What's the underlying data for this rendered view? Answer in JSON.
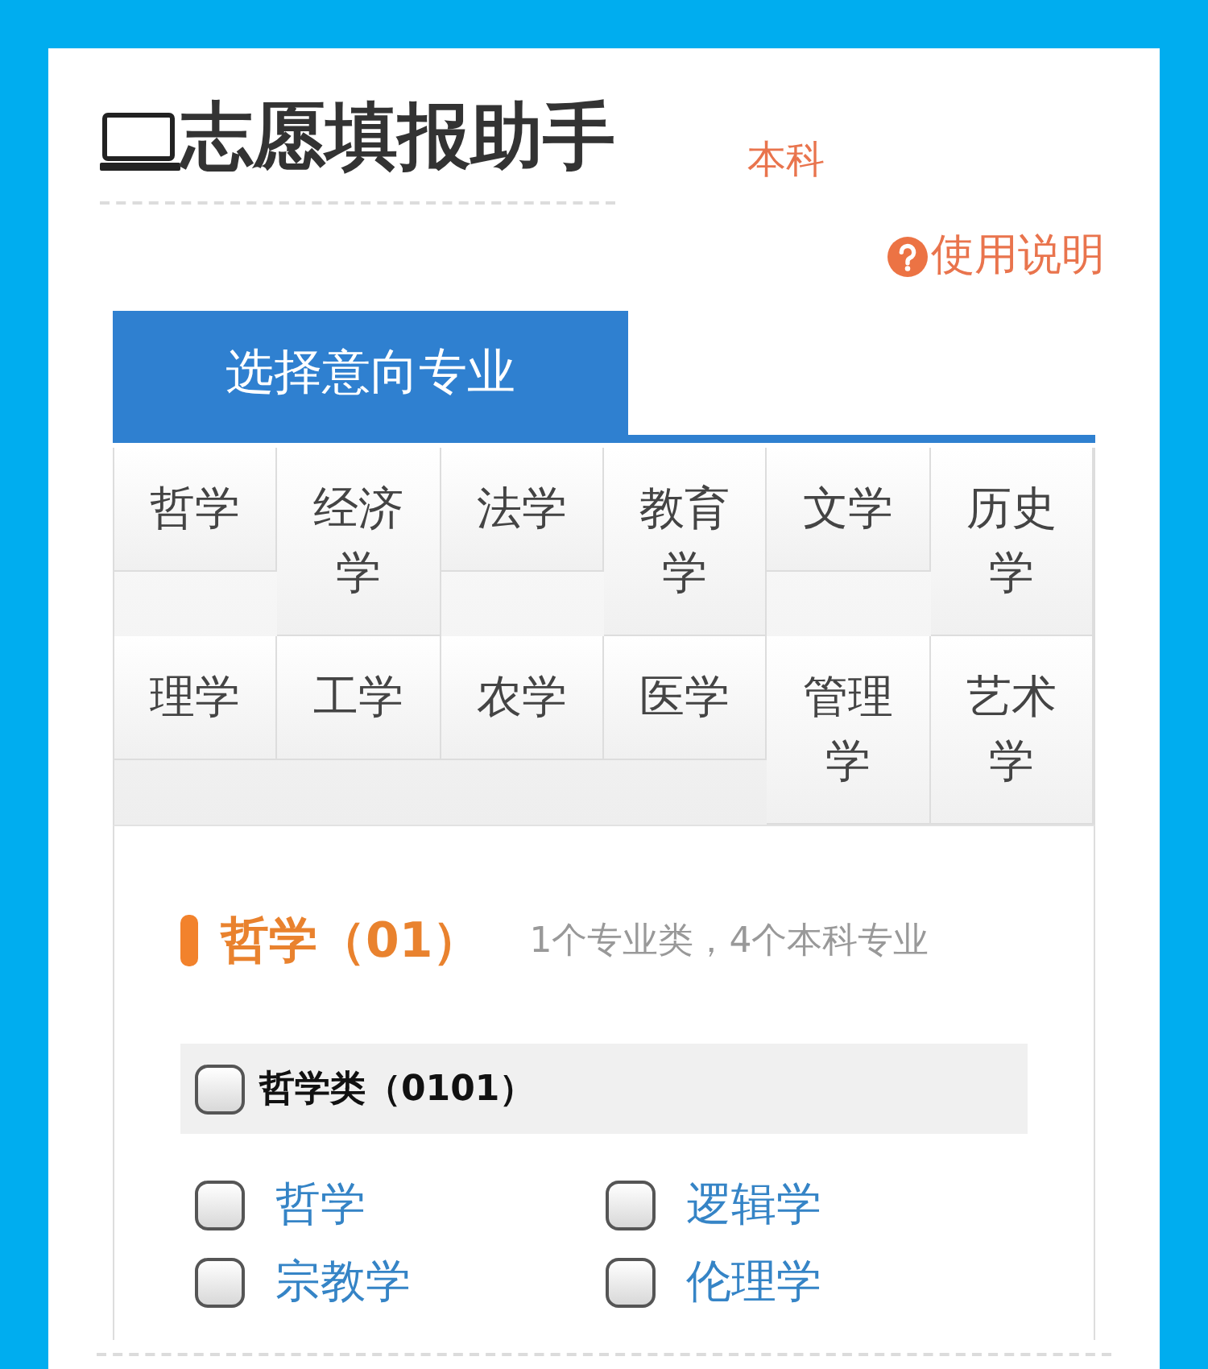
{
  "header": {
    "title": "志愿填报助手",
    "level_label": "本科",
    "help_link": "使用说明"
  },
  "panel": {
    "tab": "选择意向专业",
    "categories": [
      {
        "label": "哲学"
      },
      {
        "label": "经济学"
      },
      {
        "label": "法学"
      },
      {
        "label": "教育学"
      },
      {
        "label": "文学"
      },
      {
        "label": "历史学"
      },
      {
        "label": "理学"
      },
      {
        "label": "工学"
      },
      {
        "label": "农学"
      },
      {
        "label": "医学"
      },
      {
        "label": "管理学"
      },
      {
        "label": "艺术学"
      }
    ]
  },
  "section": {
    "title": "哲学（01）",
    "summary": "1个专业类，4个本科专业",
    "groups": [
      {
        "label": "哲学类（0101）",
        "checked": false,
        "majors": [
          {
            "label": "哲学",
            "checked": false
          },
          {
            "label": "逻辑学",
            "checked": false
          },
          {
            "label": "宗教学",
            "checked": false
          },
          {
            "label": "伦理学",
            "checked": false
          }
        ]
      }
    ]
  }
}
